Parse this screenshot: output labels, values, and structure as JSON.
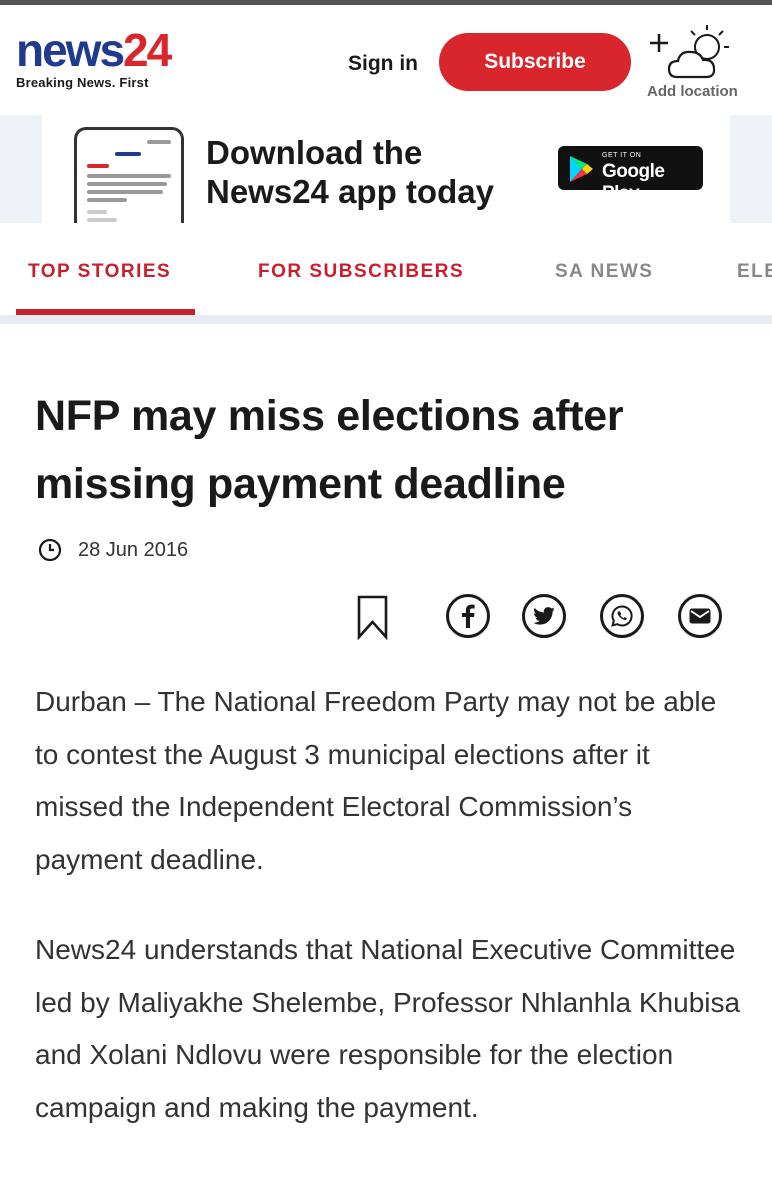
{
  "header": {
    "logo_news": "news",
    "logo_num": "24",
    "tagline": "Breaking News. First",
    "signin_label": "Sign in",
    "subscribe_label": "Subscribe",
    "add_location_label": "Add location"
  },
  "banner": {
    "line1": "Download the",
    "line2": "News24 app today",
    "store_small": "GET IT ON",
    "store_big": "Google Play"
  },
  "nav": {
    "items": [
      {
        "label": "TOP STORIES",
        "active": true
      },
      {
        "label": "FOR SUBSCRIBERS",
        "active": false
      },
      {
        "label": "SA NEWS",
        "active": false
      },
      {
        "label": "ELE",
        "active": false
      }
    ]
  },
  "article": {
    "title_line1": "NFP may miss elections after",
    "title_line2": "missing payment deadline",
    "date": "28 Jun 2016",
    "paragraph1": "Durban – The National Freedom Party may not be able to contest the August 3 municipal elections after it missed the Independent Electoral Commission’s payment deadline.",
    "paragraph2": "News24 understands that National Executive Committee led by Maliyakhe Shelembe, Professor Nhlanhla Khubisa and Xolani Ndlovu were responsible for the election campaign and making the payment."
  },
  "share": {
    "icons": [
      "bookmark-icon",
      "facebook-icon",
      "twitter-icon",
      "whatsapp-icon",
      "email-icon"
    ]
  },
  "colors": {
    "brand_blue": "#1f3a8f",
    "brand_red": "#d8262c",
    "nav_red": "#c8202a"
  }
}
